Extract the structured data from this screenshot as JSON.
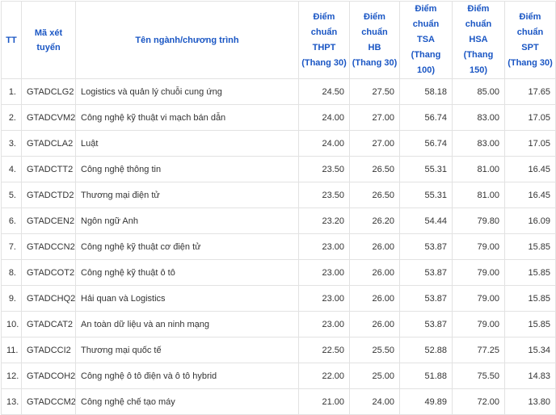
{
  "table": {
    "headers": {
      "tt": "TT",
      "code": "Mã xét tuyển",
      "name": "Tên ngành/chương trình",
      "thpt": [
        "Điểm chuẩn",
        "THPT",
        "(Thang 30)"
      ],
      "hb": [
        "Điểm chuẩn",
        "HB",
        "(Thang 30)"
      ],
      "tsa": [
        "Điểm chuẩn",
        "TSA",
        "(Thang 100)"
      ],
      "hsa": [
        "Điểm chuẩn",
        "HSA",
        "(Thang 150)"
      ],
      "spt": [
        "Điểm chuẩn",
        "SPT",
        "(Thang 30)"
      ]
    },
    "rows": [
      {
        "tt": "1.",
        "code": "GTADCLG2",
        "name": "Logistics và quản lý chuỗi cung ứng",
        "thpt": "24.50",
        "hb": "27.50",
        "tsa": "58.18",
        "hsa": "85.00",
        "spt": "17.65"
      },
      {
        "tt": "2.",
        "code": "GTADCVM2",
        "name": "Công nghệ kỹ thuật vi mạch bán dẫn",
        "thpt": "24.00",
        "hb": "27.00",
        "tsa": "56.74",
        "hsa": "83.00",
        "spt": "17.05"
      },
      {
        "tt": "3.",
        "code": "GTADCLA2",
        "name": "Luật",
        "thpt": "24.00",
        "hb": "27.00",
        "tsa": "56.74",
        "hsa": "83.00",
        "spt": "17.05"
      },
      {
        "tt": "4.",
        "code": "GTADCTT2",
        "name": "Công nghệ thông tin",
        "thpt": "23.50",
        "hb": "26.50",
        "tsa": "55.31",
        "hsa": "81.00",
        "spt": "16.45"
      },
      {
        "tt": "5.",
        "code": "GTADCTD2",
        "name": "Thương mại điện tử",
        "thpt": "23.50",
        "hb": "26.50",
        "tsa": "55.31",
        "hsa": "81.00",
        "spt": "16.45"
      },
      {
        "tt": "6.",
        "code": "GTADCEN2",
        "name": "Ngôn ngữ Anh",
        "thpt": "23.20",
        "hb": "26.20",
        "tsa": "54.44",
        "hsa": "79.80",
        "spt": "16.09"
      },
      {
        "tt": "7.",
        "code": "GTADCCN2",
        "name": "Công nghệ kỹ thuật cơ điện tử",
        "thpt": "23.00",
        "hb": "26.00",
        "tsa": "53.87",
        "hsa": "79.00",
        "spt": "15.85"
      },
      {
        "tt": "8.",
        "code": "GTADCOT2",
        "name": "Công nghệ kỹ thuật ô tô",
        "thpt": "23.00",
        "hb": "26.00",
        "tsa": "53.87",
        "hsa": "79.00",
        "spt": "15.85"
      },
      {
        "tt": "9.",
        "code": "GTADCHQ2",
        "name": "Hải quan và Logistics",
        "thpt": "23.00",
        "hb": "26.00",
        "tsa": "53.87",
        "hsa": "79.00",
        "spt": "15.85"
      },
      {
        "tt": "10.",
        "code": "GTADCAT2",
        "name": "An toàn dữ liệu và an ninh mạng",
        "thpt": "23.00",
        "hb": "26.00",
        "tsa": "53.87",
        "hsa": "79.00",
        "spt": "15.85"
      },
      {
        "tt": "11.",
        "code": "GTADCCI2",
        "name": "Thương mại quốc tế",
        "thpt": "22.50",
        "hb": "25.50",
        "tsa": "52.88",
        "hsa": "77.25",
        "spt": "15.34"
      },
      {
        "tt": "12.",
        "code": "GTADCOH2",
        "name": "Công nghệ ô tô điện và ô tô hybrid",
        "thpt": "22.00",
        "hb": "25.00",
        "tsa": "51.88",
        "hsa": "75.50",
        "spt": "14.83"
      },
      {
        "tt": "13.",
        "code": "GTADCCM2",
        "name": "Công nghệ chế tạo máy",
        "thpt": "21.00",
        "hb": "24.00",
        "tsa": "49.89",
        "hsa": "72.00",
        "spt": "13.80"
      }
    ]
  }
}
